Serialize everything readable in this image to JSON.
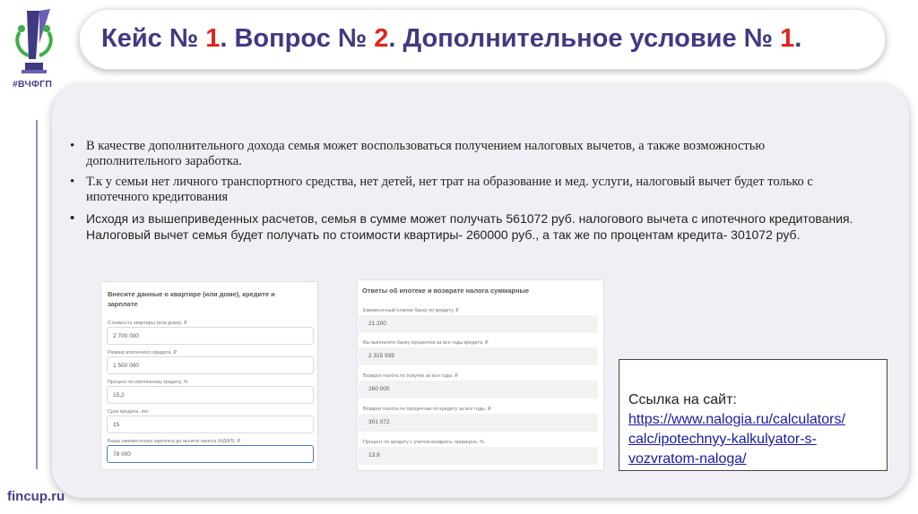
{
  "brand": {
    "tag": "#ВЧФГП",
    "footer": "fincup.ru"
  },
  "title": {
    "p1": "Кейс № ",
    "n1": "1",
    "p2": ". Вопрос № ",
    "n2": "2",
    "p3": ". Дополнительное условие № ",
    "n3": "1",
    "p4": "."
  },
  "bullets": [
    "В качестве дополнительного дохода семья может воспользоваться получением налоговых вычетов, а также возможностью дополнительного заработка.",
    "Т.к у семьи нет личного транспортного средства, нет детей, нет трат на образование и мед. услуги, налоговый вычет будет только с ипотечного кредитования",
    "Исходя из вышеприведенных расчетов, семья в сумме может получать 561072 руб. налогового вычета с ипотечного кредитования. Налоговый вычет семья будет получать по стоимости квартиры- 260000 руб., а так же по процентам кредита- 301072 руб."
  ],
  "input_card": {
    "heading": "Внесите данные о квартире (или доме), кредите и зарплате",
    "fields": [
      {
        "label": "Стоимость квартиры (или дома), ₽",
        "value": "2 700 000"
      },
      {
        "label": "Размер ипотечного кредита, ₽",
        "value": "1 500 000"
      },
      {
        "label": "Процент по ипотечному кредиту, %",
        "value": "15,2"
      },
      {
        "label": "Срок кредита, лет",
        "value": "15"
      },
      {
        "label": "Ваша ежемесячная зарплата до вычета налога (НДФЛ), ₽",
        "value": "78 000"
      }
    ]
  },
  "result_card": {
    "heading": "Ответы об ипотеке и возврате налога суммарные",
    "fields": [
      {
        "label": "Ежемесячный платеж банку по кредиту, ₽",
        "value": "21 200"
      },
      {
        "label": "Вы выплатите банку процентов за все годы кредита, ₽",
        "value": "2 315 939"
      },
      {
        "label": "Возврат налога по покупке за все годы, ₽",
        "value": "260 000"
      },
      {
        "label": "Возврат налога по процентам по кредиту за все годы, ₽",
        "value": "301 072"
      },
      {
        "label": "Процент по кредиту с учетом возврата, примерно, %",
        "value": "13.9"
      }
    ]
  },
  "link_box": {
    "label": "Ссылка на сайт:",
    "url_lines": [
      "https://www.nalogia.ru/calculators/",
      "calc/ipotechnyy-kalkulyator-s-",
      "vozvratom-naloga/"
    ]
  },
  "colors": {
    "brand_purple": "#3f3a82",
    "accent_red": "#e2231a",
    "link": "#1a1aa6"
  }
}
